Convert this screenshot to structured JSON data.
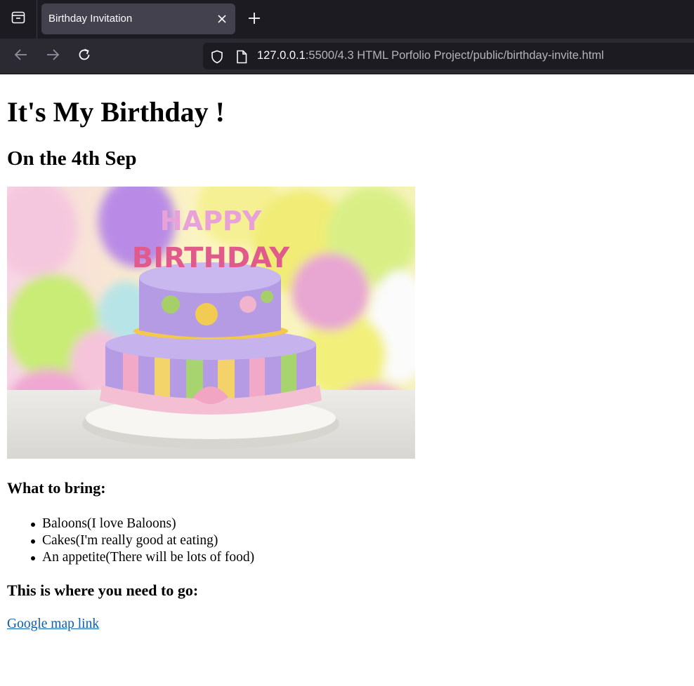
{
  "browser": {
    "tab": {
      "title": "Birthday Invitation"
    },
    "url": {
      "host": "127.0.0.1",
      "path": ":5500/4.3 HTML Porfolio Project/public/birthday-invite.html"
    },
    "icons": [
      "tab-overview-icon",
      "close-icon",
      "plus-icon",
      "back-arrow-icon",
      "forward-arrow-icon",
      "reload-icon",
      "shield-icon",
      "page-icon"
    ]
  },
  "page": {
    "title": "It's My Birthday !",
    "date": "On the 4th Sep",
    "bring_heading": "What to bring:",
    "items": [
      "Baloons(I love Baloons)",
      "Cakes(I'm really good at eating)",
      "An appetite(There will be lots of food)"
    ],
    "go_heading": "This is where you need to go:",
    "map_link": "Google map link",
    "image": {
      "cake_lettering_top": "HAPPY",
      "cake_lettering_bottom": "BIRTHDAY"
    }
  },
  "colors": {
    "tabbar_bg": "#1c1b22",
    "tab_active_bg": "#42414d",
    "navbar_bg": "#2b2a33",
    "link": "#0b5fb0"
  }
}
